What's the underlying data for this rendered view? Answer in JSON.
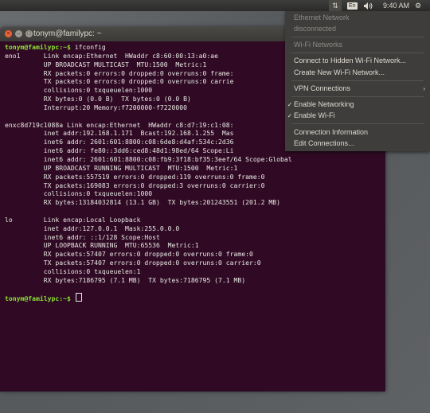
{
  "panel": {
    "network_icon": "network-arrows-icon",
    "keyboard_layout": "En",
    "volume_icon": "speaker-icon",
    "clock": "9:40 AM",
    "settings_icon": "gear-icon"
  },
  "terminal": {
    "title": "tonym@familypc: ~",
    "lines": [
      {
        "prompt": "tonym@familypc:~$",
        "text": " ifconfig"
      },
      {
        "prompt": "",
        "text": "eno1      Link encap:Ethernet  HWaddr c8:60:00:13:a0:ae"
      },
      {
        "prompt": "",
        "text": "          UP BROADCAST MULTICAST  MTU:1500  Metric:1"
      },
      {
        "prompt": "",
        "text": "          RX packets:0 errors:0 dropped:0 overruns:0 frame:"
      },
      {
        "prompt": "",
        "text": "          TX packets:0 errors:0 dropped:0 overruns:0 carrie"
      },
      {
        "prompt": "",
        "text": "          collisions:0 txqueuelen:1000"
      },
      {
        "prompt": "",
        "text": "          RX bytes:0 (0.0 B)  TX bytes:0 (0.0 B)"
      },
      {
        "prompt": "",
        "text": "          Interrupt:20 Memory:f7200000-f7220000"
      },
      {
        "prompt": "",
        "text": ""
      },
      {
        "prompt": "",
        "text": "enxc8d719c1088a Link encap:Ethernet  HWaddr c8:d7:19:c1:08:"
      },
      {
        "prompt": "",
        "text": "          inet addr:192.168.1.171  Bcast:192.168.1.255  Mas"
      },
      {
        "prompt": "",
        "text": "          inet6 addr: 2601:601:8800:c08:6de8:d4af:534c:2d36"
      },
      {
        "prompt": "",
        "text": "          inet6 addr: fe80::3dd6:ced8:48d1:98ed/64 Scope:Li"
      },
      {
        "prompt": "",
        "text": "          inet6 addr: 2601:601:8800:c08:fb9:3f18:bf35:3eef/64 Scope:Global"
      },
      {
        "prompt": "",
        "text": "          UP BROADCAST RUNNING MULTICAST  MTU:1500  Metric:1"
      },
      {
        "prompt": "",
        "text": "          RX packets:557519 errors:0 dropped:119 overruns:0 frame:0"
      },
      {
        "prompt": "",
        "text": "          TX packets:169083 errors:0 dropped:3 overruns:0 carrier:0"
      },
      {
        "prompt": "",
        "text": "          collisions:0 txqueuelen:1000"
      },
      {
        "prompt": "",
        "text": "          RX bytes:13184032814 (13.1 GB)  TX bytes:201243551 (201.2 MB)"
      },
      {
        "prompt": "",
        "text": ""
      },
      {
        "prompt": "",
        "text": "lo        Link encap:Local Loopback"
      },
      {
        "prompt": "",
        "text": "          inet addr:127.0.0.1  Mask:255.0.0.0"
      },
      {
        "prompt": "",
        "text": "          inet6 addr: ::1/128 Scope:Host"
      },
      {
        "prompt": "",
        "text": "          UP LOOPBACK RUNNING  MTU:65536  Metric:1"
      },
      {
        "prompt": "",
        "text": "          RX packets:57407 errors:0 dropped:0 overruns:0 frame:0"
      },
      {
        "prompt": "",
        "text": "          TX packets:57407 errors:0 dropped:0 overruns:0 carrier:0"
      },
      {
        "prompt": "",
        "text": "          collisions:0 txqueuelen:1"
      },
      {
        "prompt": "",
        "text": "          RX bytes:7186795 (7.1 MB)  TX bytes:7186795 (7.1 MB)"
      },
      {
        "prompt": "",
        "text": ""
      },
      {
        "prompt": "tonym@familypc:~$",
        "text": " "
      }
    ]
  },
  "network_menu": {
    "ethernet_header": "Ethernet Network",
    "ethernet_status": "disconnected",
    "wifi_header": "Wi-Fi Networks",
    "connect_hidden": "Connect to Hidden Wi-Fi Network...",
    "create_new": "Create New Wi-Fi Network...",
    "vpn": "VPN Connections",
    "enable_networking": "Enable Networking",
    "enable_wifi": "Enable Wi-Fi",
    "connection_info": "Connection Information",
    "edit_connections": "Edit Connections...",
    "check_glyph": "✓",
    "submenu_arrow": "›"
  }
}
